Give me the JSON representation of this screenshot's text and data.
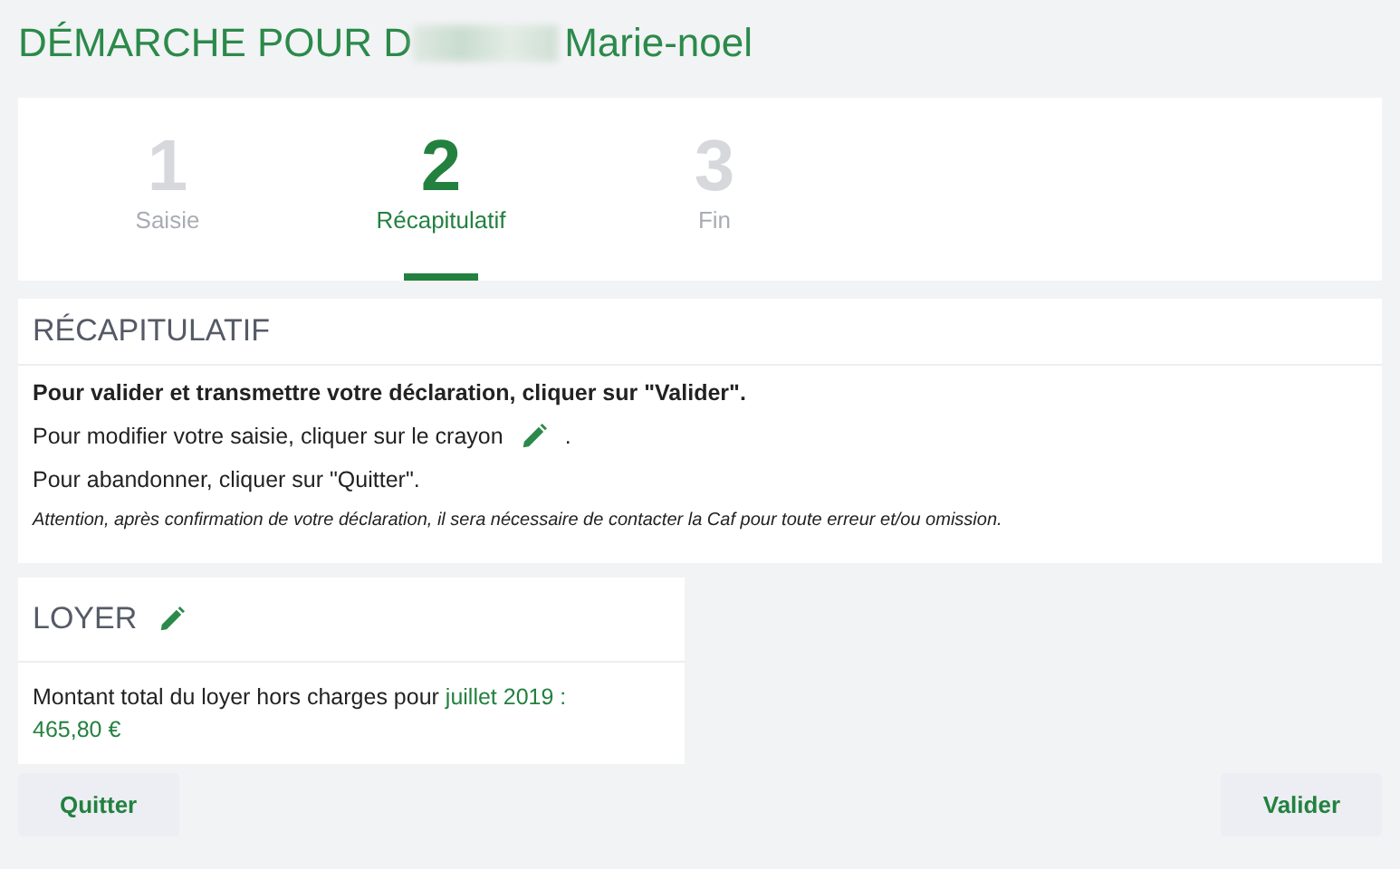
{
  "page_title": {
    "start": "DÉMARCHE POUR D",
    "end": "Marie-noel"
  },
  "steps": [
    {
      "number": "1",
      "label": "Saisie",
      "selected": false
    },
    {
      "number": "2",
      "label": "Récapitulatif",
      "selected": true
    },
    {
      "number": "3",
      "label": "Fin",
      "selected": false
    }
  ],
  "recap": {
    "title": "RÉCAPITULATIF",
    "instruction_validate": "Pour valider et transmettre votre déclaration, cliquer sur \"Valider\".",
    "instruction_edit": "Pour modifier votre saisie, cliquer sur le crayon",
    "instruction_edit_end": ".",
    "instruction_quit": "Pour abandonner, cliquer sur \"Quitter\".",
    "warning": "Attention, après confirmation de votre déclaration, il sera nécessaire de contacter la Caf pour toute erreur et/ou omission."
  },
  "rent": {
    "title": "LOYER",
    "label": "Montant total du loyer hors charges pour",
    "period": "juillet 2019 :",
    "amount": "465,80 €"
  },
  "buttons": [
    {
      "label": "Quitter"
    },
    {
      "label": "Valider"
    }
  ]
}
